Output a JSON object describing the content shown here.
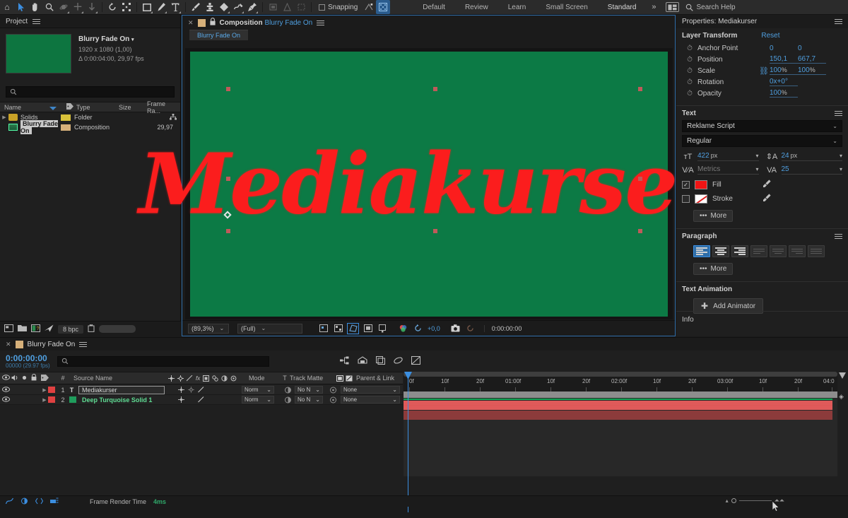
{
  "app": {
    "name": "Adobe After Effects"
  },
  "toolbar": {
    "tools": [
      {
        "name": "home-icon",
        "glyph": "⌂"
      },
      {
        "name": "selection-tool-icon",
        "glyph": "➤"
      },
      {
        "name": "hand-tool-icon",
        "glyph": "✋"
      },
      {
        "name": "zoom-tool-icon",
        "glyph": "🔍"
      },
      {
        "name": "orbit-tool-icon",
        "glyph": "◉"
      },
      {
        "name": "pan-tool-icon",
        "glyph": "✛"
      },
      {
        "name": "dolly-tool-icon",
        "glyph": "↧"
      },
      {
        "name": "rotation-tool-icon",
        "glyph": "↺"
      },
      {
        "name": "anchor-point-tool-icon",
        "glyph": "⛶"
      },
      {
        "name": "shape-tool-icon",
        "glyph": "▭"
      },
      {
        "name": "pen-tool-icon",
        "glyph": "✒"
      },
      {
        "name": "type-tool-icon",
        "glyph": "T"
      },
      {
        "name": "brush-tool-icon",
        "glyph": "🖌"
      },
      {
        "name": "clone-stamp-tool-icon",
        "glyph": "⚲"
      },
      {
        "name": "eraser-tool-icon",
        "glyph": "◆"
      },
      {
        "name": "roto-brush-tool-icon",
        "glyph": "⌇"
      },
      {
        "name": "puppet-pin-tool-icon",
        "glyph": "✚"
      }
    ],
    "snapping_label": "Snapping"
  },
  "workspaces": {
    "items": [
      "Default",
      "Review",
      "Learn",
      "Small Screen",
      "Standard"
    ],
    "active": "Standard",
    "more": "»",
    "search_help": "Search Help"
  },
  "project": {
    "title": "Project",
    "comp_name": "Blurry Fade On",
    "comp_resolution": "1920 x 1080 (1,00)",
    "comp_duration": "Δ 0:00:04:00, 29,97 fps",
    "search_placeholder": "",
    "columns": [
      "Name",
      "Type",
      "Size",
      "Frame Ra..."
    ],
    "rows": [
      {
        "name": "Solids",
        "type": "Folder",
        "size": "",
        "frame_rate": "",
        "icon": "folder-icon",
        "selected": false
      },
      {
        "name": "Blurry Fade On",
        "type": "Composition",
        "size": "",
        "frame_rate": "29,97",
        "icon": "composition-icon",
        "selected": true
      }
    ],
    "footer": {
      "bit_depth": "8 bpc"
    }
  },
  "composition": {
    "panel_label": "Composition",
    "comp_name": "Blurry Fade On",
    "tab_label": "Blurry Fade On",
    "stage_text": "Mediakurser",
    "stage_bg_color": "#0c7a45",
    "stage_text_color": "#fb1d1d",
    "footer": {
      "zoom": "(89,3%)",
      "resolution": "(Full)",
      "exposure": "+0,0",
      "timecode": "0:00:00:00"
    }
  },
  "properties": {
    "title": "Properties: Mediakurser",
    "layer_transform": {
      "heading": "Layer Transform",
      "reset": "Reset",
      "rows": [
        {
          "label": "Anchor Point",
          "v1": "0",
          "v2": "0",
          "unit1": "",
          "unit2": ""
        },
        {
          "label": "Position",
          "v1": "150,1",
          "v2": "667,7",
          "unit1": "",
          "unit2": ""
        },
        {
          "label": "Scale",
          "v1": "100",
          "v2": "100",
          "unit1": "%",
          "unit2": "%",
          "linked": true
        },
        {
          "label": "Rotation",
          "v1": "0x+0°",
          "v2": "",
          "unit1": "",
          "unit2": ""
        },
        {
          "label": "Opacity",
          "v1": "100",
          "v2": "",
          "unit1": "%",
          "unit2": ""
        }
      ]
    },
    "text": {
      "heading": "Text",
      "font_family": "Reklame Script",
      "font_style": "Regular",
      "font_size": "422",
      "font_size_unit": "px",
      "leading": "24",
      "leading_unit": "px",
      "kerning": "Metrics",
      "tracking": "25",
      "fill_label": "Fill",
      "fill_color": "#f01414",
      "fill_checked": true,
      "stroke_label": "Stroke",
      "stroke_checked": false,
      "more_label": "More"
    },
    "paragraph": {
      "heading": "Paragraph",
      "more_label": "More",
      "active_align": 0
    },
    "text_animation": {
      "heading": "Text Animation",
      "add_animator": "Add Animator"
    },
    "info": {
      "heading": "Info"
    }
  },
  "timeline": {
    "tab_label": "Blurry Fade On",
    "current_time": "0:00:00:00",
    "current_frame": "00000 (29.97 fps)",
    "search_placeholder": "",
    "columns": {
      "num": "#",
      "source_name": "Source Name",
      "mode": "Mode",
      "track_matte_t": "T",
      "track_matte": "Track Matte",
      "parent_link": "Parent & Link"
    },
    "layers": [
      {
        "index": "1",
        "name": "Mediakurser",
        "label_color": "#e04141",
        "type": "text",
        "editing": true,
        "mode": "Norm",
        "track_matte": "No N",
        "parent": "None"
      },
      {
        "index": "2",
        "name": "Deep Turquoise Solid 1",
        "label_color": "#1f9d5c",
        "type": "solid",
        "editing": false,
        "mode": "Norm",
        "track_matte": "No N",
        "parent": "None"
      }
    ],
    "ruler_ticks": [
      "0f",
      "10f",
      "20f",
      "01:00f",
      "10f",
      "20f",
      "02:00f",
      "10f",
      "20f",
      "03:00f",
      "10f",
      "20f",
      "04:0"
    ],
    "footer": {
      "frame_render_label": "Frame Render Time",
      "frame_render_value": "4ms"
    }
  }
}
